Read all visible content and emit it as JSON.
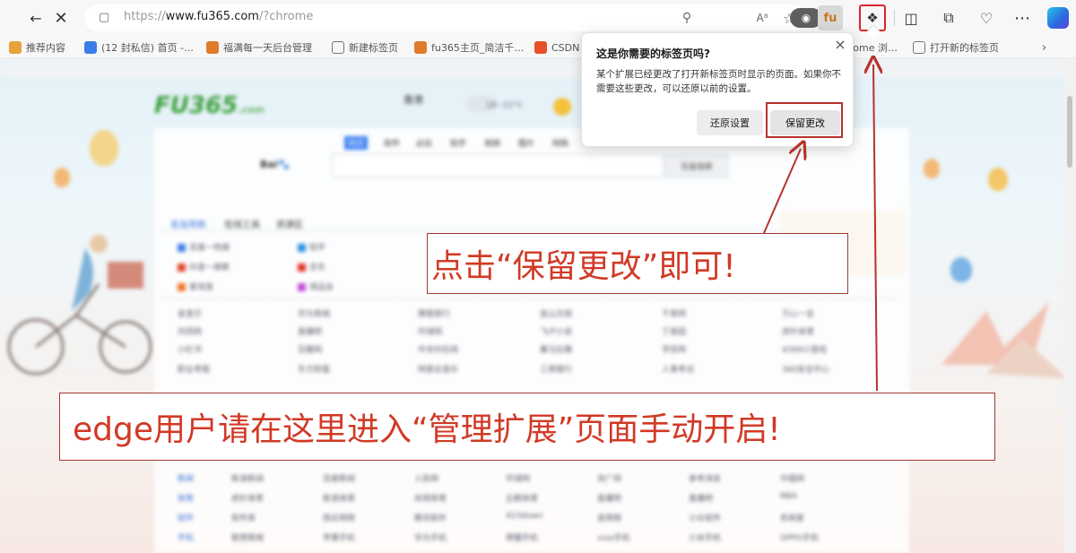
{
  "browser": {
    "url_prefix": "https://",
    "url_host": "www.fu365.com",
    "url_path": "/?chrome",
    "extension_fu_label": "fu"
  },
  "favorites": [
    {
      "label": "推荐内容",
      "color": "#e8a23a"
    },
    {
      "label": "(12 封私信) 首页 -…",
      "color": "#3b7de8"
    },
    {
      "label": "福满每一天后台管理",
      "color": "#e07b2a"
    },
    {
      "label": "新建标签页",
      "color": "#666666"
    },
    {
      "label": "fu365主页_简洁千…",
      "color": "#e07b2a"
    },
    {
      "label": "CSDN",
      "color": "#e8502a"
    },
    {
      "label": "hrome 浏…",
      "color": "#666666"
    },
    {
      "label": "打开新的标签页",
      "color": "#666666"
    }
  ],
  "popup": {
    "title": "这是你需要的标签页吗?",
    "body": "某个扩展已经更改了打开新标签页时显示的页面。如果你不需要这些更改，可以还原以前的设置。",
    "revert_label": "还原设置",
    "keep_label": "保留更改"
  },
  "annotations": {
    "keep_hint": "点击“保留更改”即可!",
    "edge_hint": "edge用户请在这里进入“管理扩展”页面手动开启!",
    "color": "#d13a26"
  },
  "page": {
    "logo": "FU365",
    "logo_suffix": ".com",
    "search_button": "百度搜索",
    "search_tabs": [
      "网页",
      "软件",
      "必应",
      "知乎",
      "视频",
      "图片",
      "网购"
    ],
    "nav_tabs": [
      "名站导航",
      "在线工具",
      "资源区"
    ],
    "weather_city": "香港",
    "weather_temp": "18~22°C",
    "sites_featured": [
      "百度一热搜",
      "知乎",
      "抖音一搜索",
      "京东",
      "爱淘宝",
      "得品会"
    ],
    "sites_grid": [
      [
        "金宝贝",
        "华为商城",
        "携程旅行",
        "金山文档",
        "千库网",
        "万心一言"
      ],
      [
        "共同网",
        "直播吧",
        "环球网",
        "飞卢小说",
        "丁香园",
        "虎扑体育"
      ],
      [
        "小红书",
        "豆瓣网",
        "中关村在线",
        "篝马拉雅",
        "学信网",
        "4399小游戏"
      ],
      [
        "职业考题",
        "东方财富",
        "网易云音乐",
        "工商银行",
        "人事考试",
        "360安全中心"
      ]
    ],
    "sites_lower": [
      [
        "新闻",
        "新浪新闻",
        "百度新闻",
        "人民网",
        "环球网",
        "央广网",
        "参考消息",
        "中国网"
      ],
      [
        "体育",
        "虎扑体育",
        "新浪体育",
        "央视体育",
        "企鹅体育",
        "直播吧",
        "直播吧",
        "NBA"
      ],
      [
        "软件",
        "软件库",
        "西瓜视频",
        "腾讯软件",
        "423down",
        "音视频",
        "小众软件",
        "系统家"
      ],
      [
        "手机",
        "联想商城",
        "苹果手机",
        "华为手机",
        "荣耀手机",
        "vivo手机",
        "小米手机",
        "OPPO手机"
      ]
    ]
  }
}
